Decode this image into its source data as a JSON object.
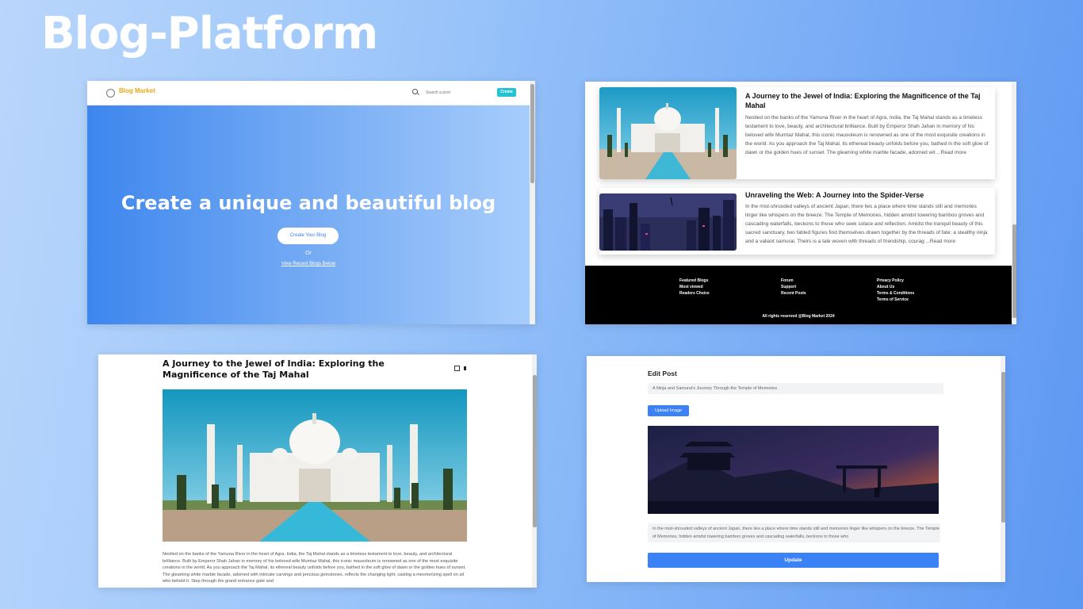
{
  "slide": {
    "title": "Blog-Platform"
  },
  "screen_home": {
    "brand": "Blog Market",
    "search_placeholder": "Search a post",
    "create_label": "Create",
    "hero_title": "Create a unique and beautiful blog",
    "hero_button": "Create Your Blog",
    "or_text": "Or",
    "view_link": "View Recent Blogs Below"
  },
  "screen_list": {
    "posts": [
      {
        "title": "A Journey to the Jewel of India: Exploring the Magnificence of the Taj Mahal",
        "excerpt": "Nestled on the banks of the Yamuna River in the heart of Agra, India, the Taj Mahal stands as a timeless testament to love, beauty, and architectural brilliance. Built by Emperor Shah Jahan in memory of his beloved wife Mumtaz Mahal, this iconic mausoleum is renowned as one of the most exquisite creations in the world. As you approach the Taj Mahal, its ethereal beauty unfolds before you, bathed in the soft glow of dawn or the golden hues of sunset. The gleaming white marble facade, adorned wit ...Read more"
      },
      {
        "title": "Unraveling the Web: A Journey into the Spider-Verse",
        "excerpt": "In the mist-shrouded valleys of ancient Japan, there lies a place where time stands still and memories linger like whispers on the breeze. The Temple of Memories, hidden amidst towering bamboo groves and cascading waterfalls, beckons to those who seek solace and reflection. Amidst the tranquil beauty of this sacred sanctuary, two fabled figures find themselves drawn together by the threads of fate: a stealthy ninja and a valiant samurai. Theirs is a tale woven with threads of friendship, courag ...Read more"
      }
    ],
    "footer": {
      "col1": [
        "Featured Blogs",
        "Most viewed",
        "Readers Choice"
      ],
      "col2": [
        "Forum",
        "Support",
        "Recent Posts"
      ],
      "col3": [
        "Privacy Policy",
        "About Us",
        "Terms & Conditions",
        "Terms of Service"
      ],
      "copyright": "All rights reserved @Blog Market 2024"
    }
  },
  "screen_post": {
    "title": "A Journey to the Jewel of India: Exploring the Magnificence of the Taj Mahal",
    "body": "Nestled on the banks of the Yamuna River in the heart of Agra, India, the Taj Mahal stands as a timeless testament to love, beauty, and architectural brilliance. Built by Emperor Shah Jahan in memory of his beloved wife Mumtaz Mahal, this iconic mausoleum is renowned as one of the most exquisite creations in the world. As you approach the Taj Mahal, its ethereal beauty unfolds before you, bathed in the soft glow of dawn or the golden hues of sunset. The gleaming white marble facade, adorned with intricate carvings and precious gemstones, reflects the changing light, casting a mesmerizing spell on all who behold it. Step through the grand entrance gate and"
  },
  "screen_edit": {
    "heading": "Edit Post",
    "title_value": "A Ninja and Samurai's Journey Through the Temple of Memories",
    "upload_label": "Upload Image",
    "content_value": "In the mist-shrouded valleys of ancient Japan, there lies a place where time stands still and memories linger like whispers on the breeze. The Temple of Memories, hidden amidst towering bamboo groves and cascading waterfalls, beckons to those who",
    "update_label": "Update"
  },
  "colors": {
    "brand": "#e6a817",
    "accent_cyan": "#22c3d3",
    "primary_blue": "#3b82f6",
    "footer_bg": "#000000"
  }
}
